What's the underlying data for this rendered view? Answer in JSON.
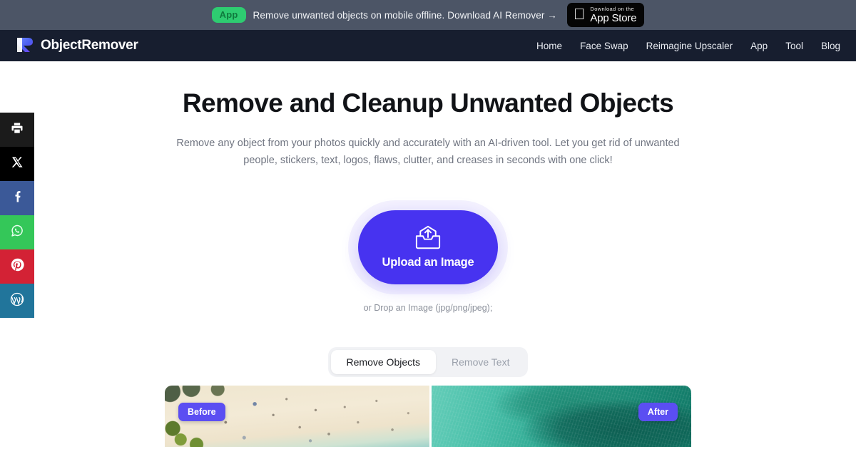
{
  "promo": {
    "pill_label": "App",
    "message": "Remove unwanted objects on mobile offline. Download AI Remover →",
    "appstore_small": "Download on the",
    "appstore_big": "App Store",
    "pill_color": "#2ecc71",
    "bar_color": "#4c5566"
  },
  "header": {
    "brand_name": "ObjectRemover",
    "bg_color": "#171e2f",
    "nav": [
      {
        "label": "Home"
      },
      {
        "label": "Face Swap"
      },
      {
        "label": "Reimagine Upscaler"
      },
      {
        "label": "App"
      },
      {
        "label": "Tool"
      },
      {
        "label": "Blog"
      }
    ]
  },
  "social_rail": [
    {
      "name": "print-icon",
      "label": "Print",
      "color": "#1b1b1b"
    },
    {
      "name": "x-twitter-icon",
      "label": "X",
      "color": "#000000"
    },
    {
      "name": "facebook-icon",
      "label": "Facebook",
      "color": "#3b5998"
    },
    {
      "name": "whatsapp-icon",
      "label": "WhatsApp",
      "color": "#34c759"
    },
    {
      "name": "pinterest-icon",
      "label": "Pinterest",
      "color": "#d32235"
    },
    {
      "name": "wordpress-icon",
      "label": "WordPress",
      "color": "#21759b"
    }
  ],
  "hero": {
    "title": "Remove and Cleanup Unwanted Objects",
    "subtitle": "Remove any object from your photos quickly and accurately with an AI-driven tool. Let you get rid of unwanted people, stickers, text, logos, flaws, clutter, and creases in seconds with one click!"
  },
  "upload": {
    "button_label": "Upload an Image",
    "drop_text": "or Drop an Image (jpg/png/jpeg);",
    "accent_color": "#4733f0"
  },
  "tabs": [
    {
      "label": "Remove Objects",
      "active": true
    },
    {
      "label": "Remove Text",
      "active": false
    }
  ],
  "comparison": {
    "before_badge": "Before",
    "after_badge": "After",
    "badge_color": "#5b4ef2"
  }
}
